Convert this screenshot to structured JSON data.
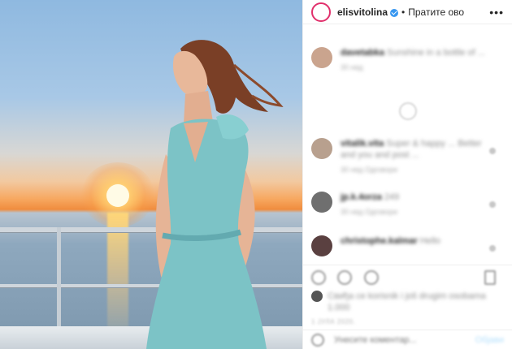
{
  "photo": {
    "sky_top": "#8fb9e0",
    "sun_color": "#fffbe6",
    "dress_color": "#7cc3c6"
  },
  "header": {
    "username": "elisvitolina",
    "separator": "•",
    "follow_label": "Пратите ово",
    "more_icon": "more-horizontal-icon"
  },
  "comments": [
    {
      "user": "davetabka",
      "text": "Sunshine in a bottle of ...",
      "meta": "30 нед"
    },
    {
      "user": "vitalik.vita",
      "text": "Super  & happy ... Better and you and post ...",
      "meta": "30 нед   Одговори"
    },
    {
      "user": "jp.k.4orza",
      "text": "249",
      "meta": "30 нед   Одговори"
    },
    {
      "user": "christophe.kalmar",
      "text": "Hello",
      "meta": ""
    }
  ],
  "likes": {
    "text": "Свиђа се korisnik i još drugim osobama 1.000"
  },
  "date": "1 ЈУЛА 2020.",
  "add_comment": {
    "placeholder": "Унесите коментар...",
    "post_label": "Објави"
  },
  "colors": {
    "accent": "#3897f0",
    "story_ring": "#e1306c"
  }
}
